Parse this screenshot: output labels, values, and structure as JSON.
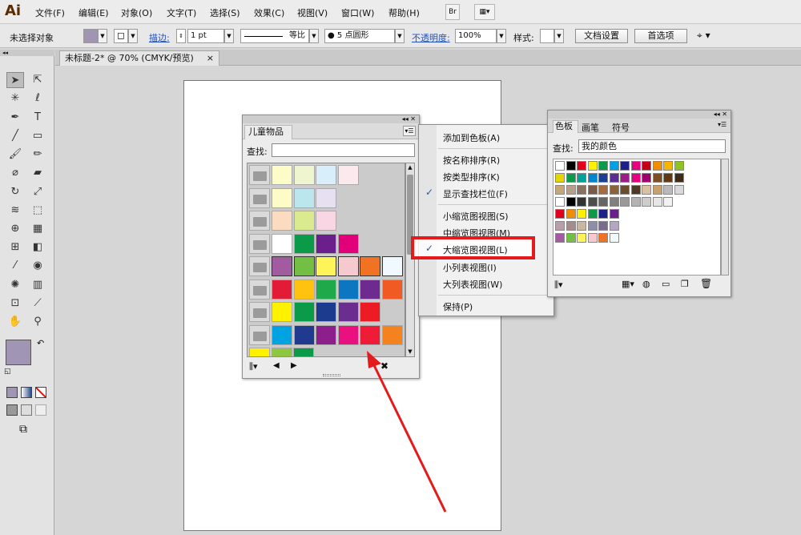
{
  "app": {
    "logo": "Ai",
    "bridge_label": "Br"
  },
  "menu": [
    "文件(F)",
    "编辑(E)",
    "对象(O)",
    "文字(T)",
    "选择(S)",
    "效果(C)",
    "视图(V)",
    "窗口(W)",
    "帮助(H)"
  ],
  "control": {
    "selection_status": "未选择对象",
    "stroke_label": "描边:",
    "stroke_weight": "1 pt",
    "line_profile": "等比",
    "brush": "5 点圆形",
    "opacity_label": "不透明度:",
    "opacity_value": "100%",
    "style_label": "样式:",
    "doc_setup": "文档设置",
    "preferences": "首选项"
  },
  "document": {
    "tab_title": "未标题-2* @ 70% (CMYK/预览)",
    "close_glyph": "×"
  },
  "library_panel": {
    "title": "儿童物品",
    "find_label": "查找:",
    "find_value": "",
    "rows": [
      [
        "#fdfbc8",
        "#eff5cf",
        "#d9eefb",
        "#fbe9ee"
      ],
      [
        "#fdfbc8",
        "#bce6ee",
        "#e6e0f0"
      ],
      [
        "#fcdcc0",
        "#d9ea8f",
        "#f8d6e4"
      ],
      [
        "#ffffff",
        "#0a9a48",
        "#6a1f8c",
        "#e2007a"
      ],
      [
        "#a25aa0",
        "#72bf44",
        "#fff35a",
        "#f6c9ce",
        "#f27224",
        "#f0fafe"
      ],
      [
        "#e21b36",
        "#ffc20e",
        "#20a94a",
        "#0d76c1",
        "#6f2a8f",
        "#f15a22"
      ],
      [
        "#fff200",
        "#0a9a48",
        "#1c3b8f",
        "#6b2d90",
        "#ed1c24"
      ],
      [
        "#00a3df",
        "#1f3a8e",
        "#8c1f8c",
        "#e8117f",
        "#ee1c36",
        "#f3821f"
      ],
      [
        "#fff200",
        "#8dc63f",
        "#0a9a48"
      ]
    ]
  },
  "flyout": {
    "items": [
      {
        "label": "添加到色板(A)",
        "checked": false
      },
      {
        "label": "按名称排序(R)",
        "checked": false
      },
      {
        "label": "按类型排序(K)",
        "checked": false
      },
      {
        "label": "显示查找栏位(F)",
        "checked": true
      },
      {
        "label": "小缩览图视图(S)",
        "checked": false
      },
      {
        "label": "中缩览图视图(M)",
        "checked": false
      },
      {
        "label": "大缩览图视图(L)",
        "checked": true
      },
      {
        "label": "小列表视图(I)",
        "checked": false
      },
      {
        "label": "大列表视图(W)",
        "checked": false
      },
      {
        "label": "保持(P)",
        "checked": false
      }
    ],
    "check_glyph": "✓"
  },
  "swatches_panel": {
    "tabs": [
      "色板",
      "画笔",
      "符号"
    ],
    "find_label": "查找:",
    "find_value": "我的颜色",
    "rows": [
      [
        "#ffffff",
        "#000000",
        "#e2001a",
        "#fff200",
        "#0a9a48",
        "#00a0e9",
        "#1d2088",
        "#e4007f",
        "#c40018",
        "#f18d00",
        "#f8b500",
        "#8fc31f"
      ],
      [
        "#e6d500",
        "#0a9a48",
        "#00a29a",
        "#0086d1",
        "#1a3f93",
        "#5b2e91",
        "#9c1d88",
        "#e4007f",
        "#a0006e",
        "#7d4e24",
        "#603813",
        "#3e2a18"
      ],
      [
        "#c7a677",
        "#b59f8a",
        "#8b7160",
        "#7a5a48",
        "#a56b3e",
        "#8c6239",
        "#6c4c2e",
        "#4e3826",
        "#d9c0a0",
        "#c9a06c",
        "#b9b9b9",
        "#d9d9d9"
      ],
      [
        "#ffffff",
        "#000000",
        "#333333",
        "#4d4d4d",
        "#666666",
        "#808080",
        "#999999",
        "#b3b3b3",
        "#cccccc",
        "#e6e6e6",
        "#f2f2f2"
      ],
      [
        "#e2001a",
        "#f18d00",
        "#fff200",
        "#0a9a48",
        "#1d2088",
        "#6a1f8c"
      ],
      [
        "#b89ea8",
        "#a48c8c",
        "#c9b7a0",
        "#8e8ea8",
        "#7a6c8c",
        "#b5a6c4"
      ],
      [
        "#a25aa0",
        "#72bf44",
        "#fff35a",
        "#f6c9ce",
        "#f27224",
        "#f0fafe"
      ]
    ]
  },
  "colors": {
    "accent_highlight": "#e51b1b",
    "fill_swatch": "#a095b3"
  }
}
